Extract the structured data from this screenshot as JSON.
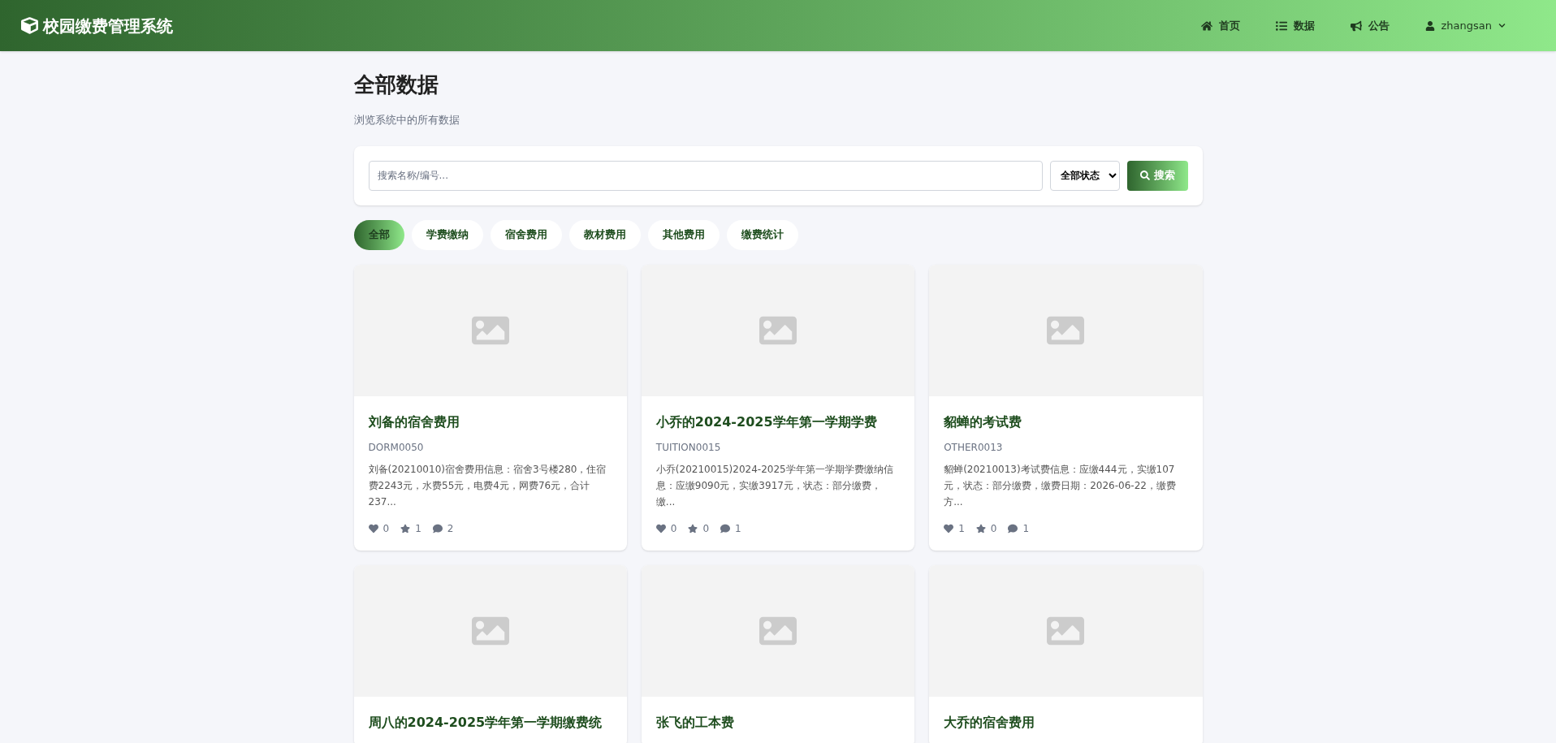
{
  "header": {
    "brand": "校园缴费管理系统",
    "nav": [
      {
        "kind": "home",
        "label": "首页"
      },
      {
        "kind": "list",
        "label": "数据"
      },
      {
        "kind": "notice",
        "label": "公告"
      }
    ],
    "user": "zhangsan"
  },
  "page": {
    "title": "全部数据",
    "subtitle": "浏览系统中的所有数据"
  },
  "search": {
    "placeholder": "搜索名称/编号...",
    "status": "全部状态",
    "button": "搜索"
  },
  "tabs": [
    {
      "label": "全部",
      "selected": true
    },
    {
      "label": "学费缴纳",
      "selected": false
    },
    {
      "label": "宿舍费用",
      "selected": false
    },
    {
      "label": "教材费用",
      "selected": false
    },
    {
      "label": "其他费用",
      "selected": false
    },
    {
      "label": "缴费统计",
      "selected": false
    }
  ],
  "cards": [
    {
      "title": "刘备的宿舍费用",
      "code": "DORM0050",
      "description": "刘备(20210010)宿舍费用信息：宿舍3号楼280，住宿费2243元，水费55元，电费4元，网费76元，合计237...",
      "likes": "0",
      "favorites": "1",
      "comments": "2"
    },
    {
      "title": "小乔的2024-2025学年第一学期学费",
      "code": "TUITION0015",
      "description": "小乔(20210015)2024-2025学年第一学期学费缴纳信息：应缴9090元，实缴3917元，状态：部分缴费，缴...",
      "likes": "0",
      "favorites": "0",
      "comments": "1"
    },
    {
      "title": "貂蝉的考试费",
      "code": "OTHER0013",
      "description": "貂蝉(20210013)考试费信息：应缴444元，实缴107元，状态：部分缴费，缴费日期：2026-06-22，缴费方...",
      "likes": "1",
      "favorites": "0",
      "comments": "1"
    },
    {
      "title": "周八的2024-2025学年第一学期缴费统"
    },
    {
      "title": "张飞的工本费"
    },
    {
      "title": "大乔的宿舍费用"
    }
  ]
}
